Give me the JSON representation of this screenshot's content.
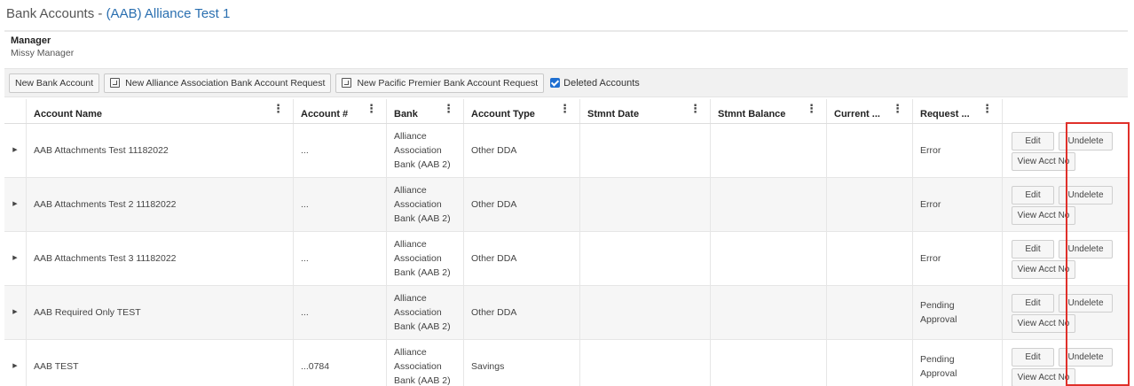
{
  "header": {
    "title_prefix": "Bank Accounts - ",
    "title_link": "(AAB) Alliance Test 1"
  },
  "manager": {
    "label": "Manager",
    "name": "Missy Manager"
  },
  "toolbar": {
    "new_bank_account": "New Bank Account",
    "new_alliance_request": "New Alliance Association Bank Account Request",
    "new_pacific_request": "New Pacific Premier Bank Account Request",
    "deleted_accounts_label": "Deleted Accounts",
    "deleted_accounts_checked": true
  },
  "columns": [
    "Account Name",
    "Account #",
    "Bank",
    "Account Type",
    "Stmnt Date",
    "Stmnt Balance",
    "Current ...",
    "Request ..."
  ],
  "rows": [
    {
      "name": "AAB Attachments Test 11182022",
      "acct": "...",
      "bank_l1": "Alliance",
      "bank_l2": "Association",
      "bank_l3": "Bank (AAB 2)",
      "type": "Other DDA",
      "stmnt_date": "",
      "stmnt_balance": "",
      "current": "",
      "req_l1": "Error",
      "req_l2": ""
    },
    {
      "name": "AAB Attachments Test 2 11182022",
      "acct": "...",
      "bank_l1": "Alliance",
      "bank_l2": "Association",
      "bank_l3": "Bank (AAB 2)",
      "type": "Other DDA",
      "stmnt_date": "",
      "stmnt_balance": "",
      "current": "",
      "req_l1": "Error",
      "req_l2": ""
    },
    {
      "name": "AAB Attachments Test 3 11182022",
      "acct": "...",
      "bank_l1": "Alliance",
      "bank_l2": "Association",
      "bank_l3": "Bank (AAB 2)",
      "type": "Other DDA",
      "stmnt_date": "",
      "stmnt_balance": "",
      "current": "",
      "req_l1": "Error",
      "req_l2": ""
    },
    {
      "name": "AAB Required Only TEST",
      "acct": "...",
      "bank_l1": "Alliance",
      "bank_l2": "Association",
      "bank_l3": "Bank (AAB 2)",
      "type": "Other DDA",
      "stmnt_date": "",
      "stmnt_balance": "",
      "current": "",
      "req_l1": "Pending",
      "req_l2": "Approval"
    },
    {
      "name": "AAB TEST",
      "acct": "...0784",
      "bank_l1": "Alliance",
      "bank_l2": "Association",
      "bank_l3": "Bank (AAB 2)",
      "type": "Savings",
      "stmnt_date": "",
      "stmnt_balance": "",
      "current": "",
      "req_l1": "Pending",
      "req_l2": "Approval"
    }
  ],
  "row_actions": {
    "edit": "Edit",
    "undelete": "Undelete",
    "view_acct_no": "View Acct No"
  },
  "icons": {
    "expand": "expand-triangle-icon",
    "column_menu": "kebab-menu-icon",
    "request_doc": "document-icon",
    "checkbox": "checkbox-checked-icon"
  },
  "colors": {
    "accent": "#2a6fb0",
    "checkbox": "#1f6fd1",
    "highlight": "#e0302a"
  }
}
